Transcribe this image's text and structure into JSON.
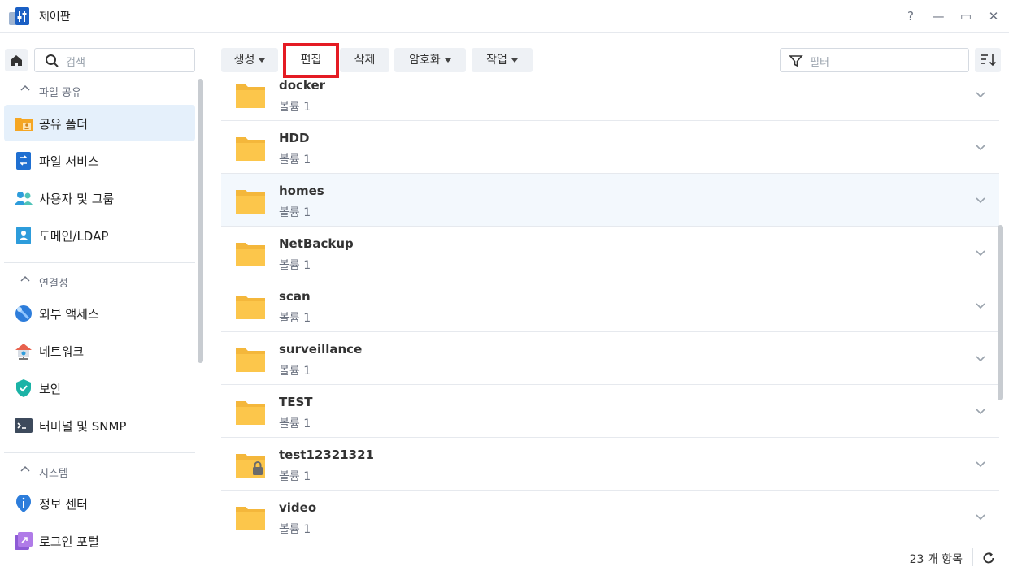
{
  "window": {
    "title": "제어판",
    "help": "?",
    "minimize": "—",
    "maximize": "▭",
    "close": "✕"
  },
  "sidebar": {
    "search_placeholder": "검색",
    "sections": [
      {
        "label": "파일 공유",
        "items": [
          "공유 폴더",
          "파일 서비스",
          "사용자 및 그룹",
          "도메인/LDAP"
        ]
      },
      {
        "label": "연결성",
        "items": [
          "외부 액세스",
          "네트워크",
          "보안",
          "터미널 및 SNMP"
        ]
      },
      {
        "label": "시스템",
        "items": [
          "정보 센터",
          "로그인 포털"
        ]
      }
    ],
    "active_item": "공유 폴더"
  },
  "toolbar": {
    "create": "생성",
    "edit": "편집",
    "delete": "삭제",
    "encrypt": "암호화",
    "action": "작업",
    "filter_placeholder": "필터"
  },
  "folders": [
    {
      "name": "docker",
      "volume": "볼륨 1",
      "locked": false
    },
    {
      "name": "HDD",
      "volume": "볼륨 1",
      "locked": false
    },
    {
      "name": "homes",
      "volume": "볼륨 1",
      "locked": false
    },
    {
      "name": "NetBackup",
      "volume": "볼륨 1",
      "locked": false
    },
    {
      "name": "scan",
      "volume": "볼륨 1",
      "locked": false
    },
    {
      "name": "surveillance",
      "volume": "볼륨 1",
      "locked": false
    },
    {
      "name": "TEST",
      "volume": "볼륨 1",
      "locked": false
    },
    {
      "name": "test12321321",
      "volume": "볼륨 1",
      "locked": true
    },
    {
      "name": "video",
      "volume": "볼륨 1",
      "locked": false
    }
  ],
  "footer": {
    "count": "23 개 항목"
  },
  "colors": {
    "accent": "#1f6fd1",
    "highlight": "#e41b23",
    "folder": "#fcc64b",
    "active_bg": "#e5f0fb"
  }
}
